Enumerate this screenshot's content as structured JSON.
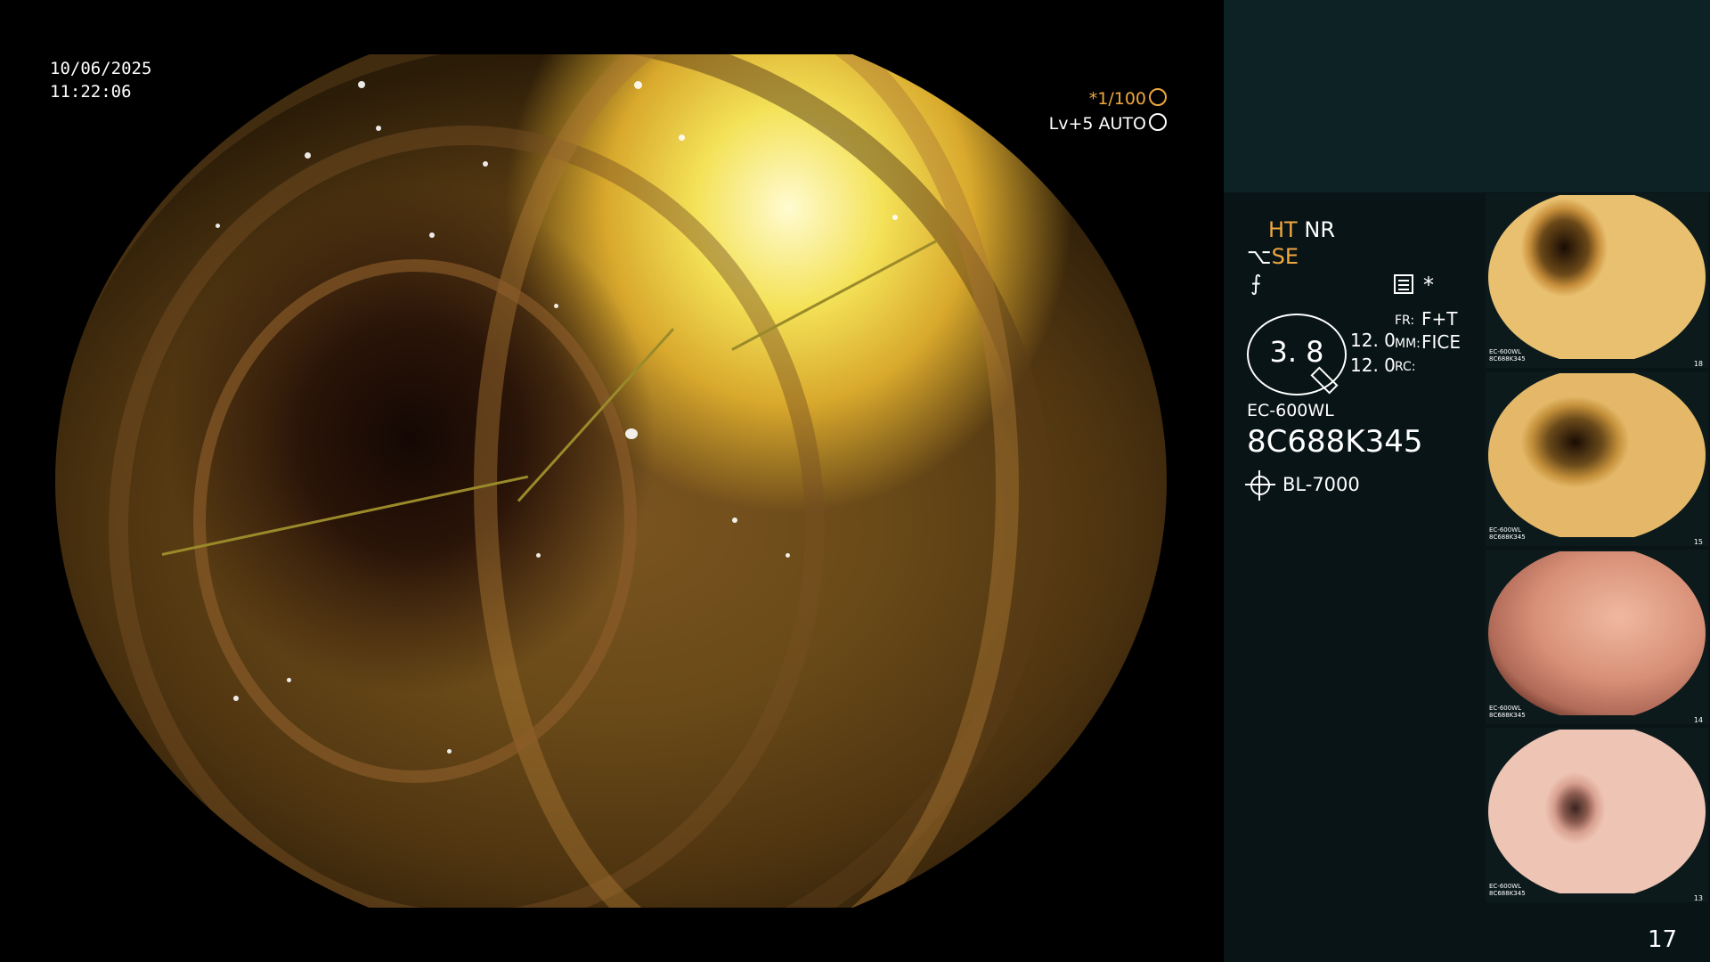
{
  "overlay": {
    "date": "10/06/2025",
    "time": "11:22:06",
    "shutter": "*1/100",
    "brightness": "Lv+5  AUTO"
  },
  "panel": {
    "ht": "HT",
    "nr": "NR",
    "se_prefix": "⌥",
    "se": "SE",
    "f_symbol": "⨍",
    "asterisk": "*",
    "gauge_value": "3. 8",
    "num_a": "12. 0",
    "num_b": "12. 0",
    "fr_label": "FR:",
    "fr_value": "F+T",
    "mm_label": "MM:",
    "mm_value": "FICE",
    "rc_label": "RC:",
    "scope_model": "EC-600WL",
    "scope_serial": "8C688K345",
    "light_source": "BL-7000",
    "page_number": "17"
  },
  "thumbnails": [
    {
      "caption": "EC-600WL\n8C688K345",
      "index": "18"
    },
    {
      "caption": "EC-600WL\n8C688K345",
      "index": "15"
    },
    {
      "caption": "EC-600WL\n8C688K345",
      "index": "14"
    },
    {
      "caption": "EC-600WL\n8C688K345",
      "index": "13"
    }
  ],
  "colors": {
    "accent": "#f0a840",
    "panel_top": "#0c2224",
    "panel_body": "#081416"
  }
}
